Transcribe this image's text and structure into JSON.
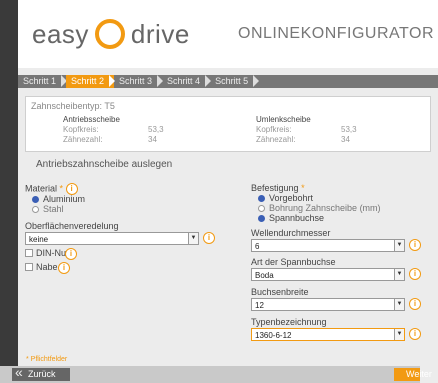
{
  "header": {
    "logo_left": "easy",
    "logo_right": "drive",
    "title": "ONLINEKONFIGURATOR"
  },
  "steps": [
    "Schritt 1",
    "Schritt 2",
    "Schritt 3",
    "Schritt 4",
    "Schritt 5"
  ],
  "active_step": 1,
  "summary": {
    "title": "Zahnscheibentyp: T5",
    "left": {
      "heading": "Antriebsscheibe",
      "kopf_label": "Kopfkreis:",
      "kopf_value": "53,3",
      "zahn_label": "Zähnezahl:",
      "zahn_value": "34"
    },
    "right": {
      "heading": "Umlenkscheibe",
      "kopf_label": "Kopfkreis:",
      "kopf_value": "53,3",
      "zahn_label": "Zähnezahl:",
      "zahn_value": "34"
    }
  },
  "section_title": "Antriebszahnscheibe auslegen",
  "material": {
    "label": "Material",
    "required": "*",
    "options": [
      "Aluminium",
      "Stahl"
    ],
    "selected": 0
  },
  "oberflaeche": {
    "label": "Oberflächenveredelung",
    "value": "keine"
  },
  "checks": {
    "din": "DIN-Nut",
    "nabe": "Nabe"
  },
  "befestigung": {
    "label": "Befestigung",
    "required": "*",
    "options": [
      "Vorgebohrt",
      "Bohrung Zahnscheibe (mm)",
      "Spannbuchse"
    ],
    "selected": 2
  },
  "wellen": {
    "label": "Wellendurchmesser",
    "value": "6"
  },
  "spannbuchse": {
    "label": "Art der Spannbuchse",
    "value": "Boda"
  },
  "buchsen": {
    "label": "Buchsenbreite",
    "value": "12"
  },
  "typen": {
    "label": "Typenbezeichnung",
    "value": "1360-6-12"
  },
  "pflicht": "* Pflichtfelder",
  "footer": {
    "back": "Zurück",
    "next": "Weiter"
  },
  "info_glyph": "i",
  "colors": {
    "accent": "#f29a12",
    "radio_selected": "#3b5fb5"
  }
}
